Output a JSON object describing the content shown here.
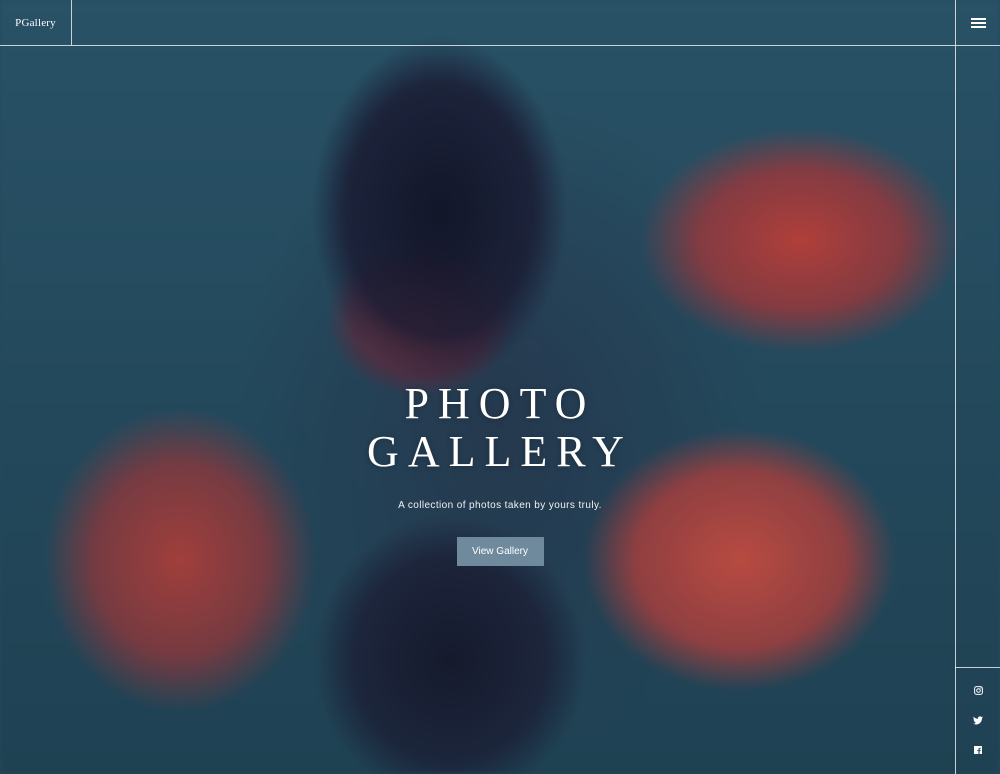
{
  "header": {
    "brand": "PGallery",
    "menu_icon": "hamburger-menu-icon"
  },
  "hero": {
    "title_line1": "PHOTO",
    "title_line2": "GALLERY",
    "subtitle": "A collection of photos taken by yours truly.",
    "button_label": "View Gallery"
  },
  "social": {
    "icons": [
      "instagram-icon",
      "twitter-icon",
      "facebook-icon"
    ]
  },
  "colors": {
    "button_bg": "#6f8a9d",
    "background": "#2b5266",
    "accent_red": "#d9463c",
    "line": "#ffffff"
  }
}
